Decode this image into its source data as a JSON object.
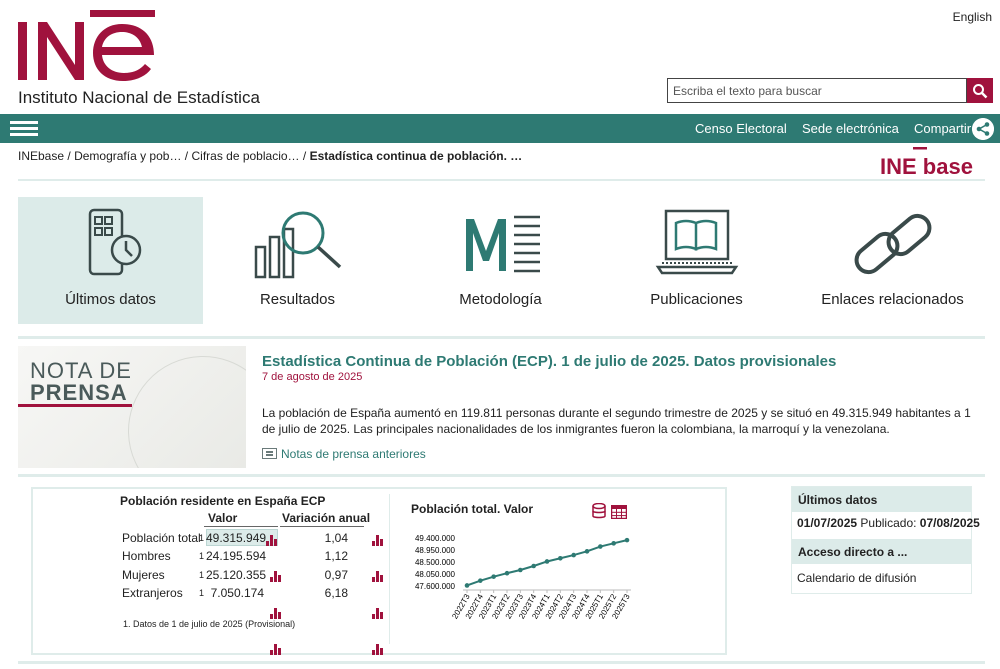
{
  "header": {
    "logo_text": "INE",
    "institute_name": "Instituto Nacional de Estadística",
    "language_link": "English",
    "search_placeholder": "Escriba el texto para buscar"
  },
  "nav": {
    "links": [
      "Censo Electoral",
      "Sede electrónica",
      "Compartir"
    ]
  },
  "breadcrumb": {
    "items": [
      "INEbase",
      "Demografía y pob…",
      "Cifras de poblacio…"
    ],
    "current": "Estadística continua de población. …",
    "separator": "/"
  },
  "inebase_logo": "INE base",
  "tiles": [
    {
      "label": "Últimos datos",
      "icon": "calendar-clock-icon",
      "active": true
    },
    {
      "label": "Resultados",
      "icon": "bar-chart-magnifier-icon",
      "active": false
    },
    {
      "label": "Metodología",
      "icon": "methodology-m-icon",
      "active": false
    },
    {
      "label": "Publicaciones",
      "icon": "laptop-book-icon",
      "active": false
    },
    {
      "label": "Enlaces relacionados",
      "icon": "chain-link-icon",
      "active": false
    }
  ],
  "press": {
    "image_text_line1": "NOTA DE",
    "image_text_line2": "PRENSA",
    "title": "Estadística Continua de Población (ECP). 1 de julio de 2025. Datos provisionales",
    "date": "7 de agosto de 2025",
    "body": "La población de España aumentó en 119.811 personas durante el segundo trimestre de 2025 y se situó en 49.315.949 habitantes a 1 de julio de 2025. Las principales nacionalidades de los inmigrantes fueron la colombiana, la marroquí y la venezolana.",
    "previous_link": "Notas de prensa anteriores"
  },
  "table": {
    "title": "Población residente en España ECP",
    "col_value": "Valor",
    "col_variation": "Variación anual",
    "rows": [
      {
        "label": "Población total",
        "note": "1",
        "value": "49.315.949",
        "variation": "1,04"
      },
      {
        "label": "Hombres",
        "note": "1",
        "value": "24.195.594",
        "variation": "1,12"
      },
      {
        "label": "Mujeres",
        "note": "1",
        "value": "25.120.355",
        "variation": "0,97"
      },
      {
        "label": "Extranjeros",
        "note": "1",
        "value": "7.050.174",
        "variation": "6,18"
      }
    ],
    "footnote": "1. Datos de 1 de julio de 2025 (Provisional)"
  },
  "chart_data": {
    "type": "line",
    "title": "Población total. Valor",
    "x": [
      "2022T3",
      "2022T4",
      "2023T1",
      "2023T2",
      "2023T3",
      "2023T4",
      "2024T1",
      "2024T2",
      "2024T3",
      "2024T4",
      "2025T1",
      "2025T2",
      "2025T3"
    ],
    "values": [
      47620000,
      47800000,
      47950000,
      48080000,
      48200000,
      48350000,
      48520000,
      48640000,
      48760000,
      48900000,
      49080000,
      49200000,
      49320000
    ],
    "yticks": [
      "49.400.000",
      "48.950.000",
      "48.500.000",
      "48.050.000",
      "47.600.000"
    ],
    "ylim": [
      47600000,
      49400000
    ],
    "color": "#2e7a73"
  },
  "side": {
    "latest_header": "Últimos datos",
    "latest_date": "01/07/2025",
    "published_label": "Publicado:",
    "published_date": "07/08/2025",
    "direct_header": "Acceso directo a ...",
    "calendar_link": "Calendario de difusión"
  },
  "colors": {
    "brand_red": "#a0123d",
    "brand_teal": "#2e7a73",
    "tile_active": "#dcebe9"
  }
}
